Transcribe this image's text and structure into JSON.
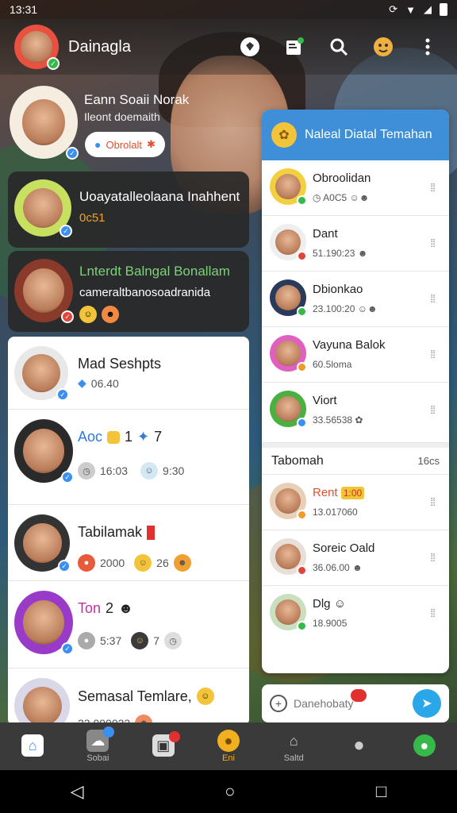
{
  "status_bar": {
    "time": "13:31"
  },
  "app_bar": {
    "title": "Dainagla"
  },
  "profile": {
    "name": "Eann Soaii Norak",
    "status": "Ileont doemaith",
    "action_label": "Obrolalt"
  },
  "featured": [
    {
      "title": "Uoayatalleolaana Inahhent",
      "subtitle": "0c51"
    },
    {
      "title": "Lnterdt Balngal Bonallam",
      "subtitle": "cameraltbanosoadranida"
    }
  ],
  "left_chats": [
    {
      "name": "Mad Seshpts",
      "meta": "06.40"
    },
    {
      "name": "Aoc",
      "meta_a": "1",
      "meta_b": "7",
      "line2a": "16:03",
      "line2b": "9:30"
    },
    {
      "name": "Tabilamak",
      "meta_a": "2000",
      "meta_b": "26"
    },
    {
      "name": "Ton",
      "meta_a": "2",
      "line2a": "5:37",
      "line2b": "7"
    },
    {
      "name": "Semasal Temlare,",
      "meta": "23.090033"
    }
  ],
  "right_panel": {
    "title": "Naleal Diatal Temahan",
    "chats": [
      {
        "name": "Obroolidan",
        "meta": "A0C5"
      },
      {
        "name": "Dant",
        "meta": "51.190:23"
      },
      {
        "name": "Dbionkao",
        "meta": "23.100:20"
      },
      {
        "name": "Vayuna Balok",
        "meta": "60.5loma"
      },
      {
        "name": "Viort",
        "meta": "33.56538"
      }
    ],
    "section": {
      "title": "Tabomah",
      "time": "16cs"
    },
    "section_chats": [
      {
        "name": "Rent",
        "tag": "1:00",
        "meta": "13.017060"
      },
      {
        "name": "Soreic Oald",
        "meta": "36.06.00"
      },
      {
        "name": "Dlg",
        "meta": "18.9005"
      }
    ]
  },
  "compose": {
    "placeholder": "Danehobaty"
  },
  "bottom_nav": [
    {
      "label": "",
      "icon": "home-icon"
    },
    {
      "label": "Sobai",
      "icon": "chat-bubble-icon"
    },
    {
      "label": "",
      "icon": "media-icon"
    },
    {
      "label": "Eni",
      "icon": "coin-icon"
    },
    {
      "label": "Saltd",
      "icon": "building-icon"
    },
    {
      "label": "",
      "icon": "person-icon"
    },
    {
      "label": "",
      "icon": "green-chat-icon"
    }
  ],
  "colors": {
    "accent_blue": "#3f8fd8",
    "send_blue": "#2aa7e8",
    "orange": "#f0a030",
    "red": "#e03030"
  }
}
